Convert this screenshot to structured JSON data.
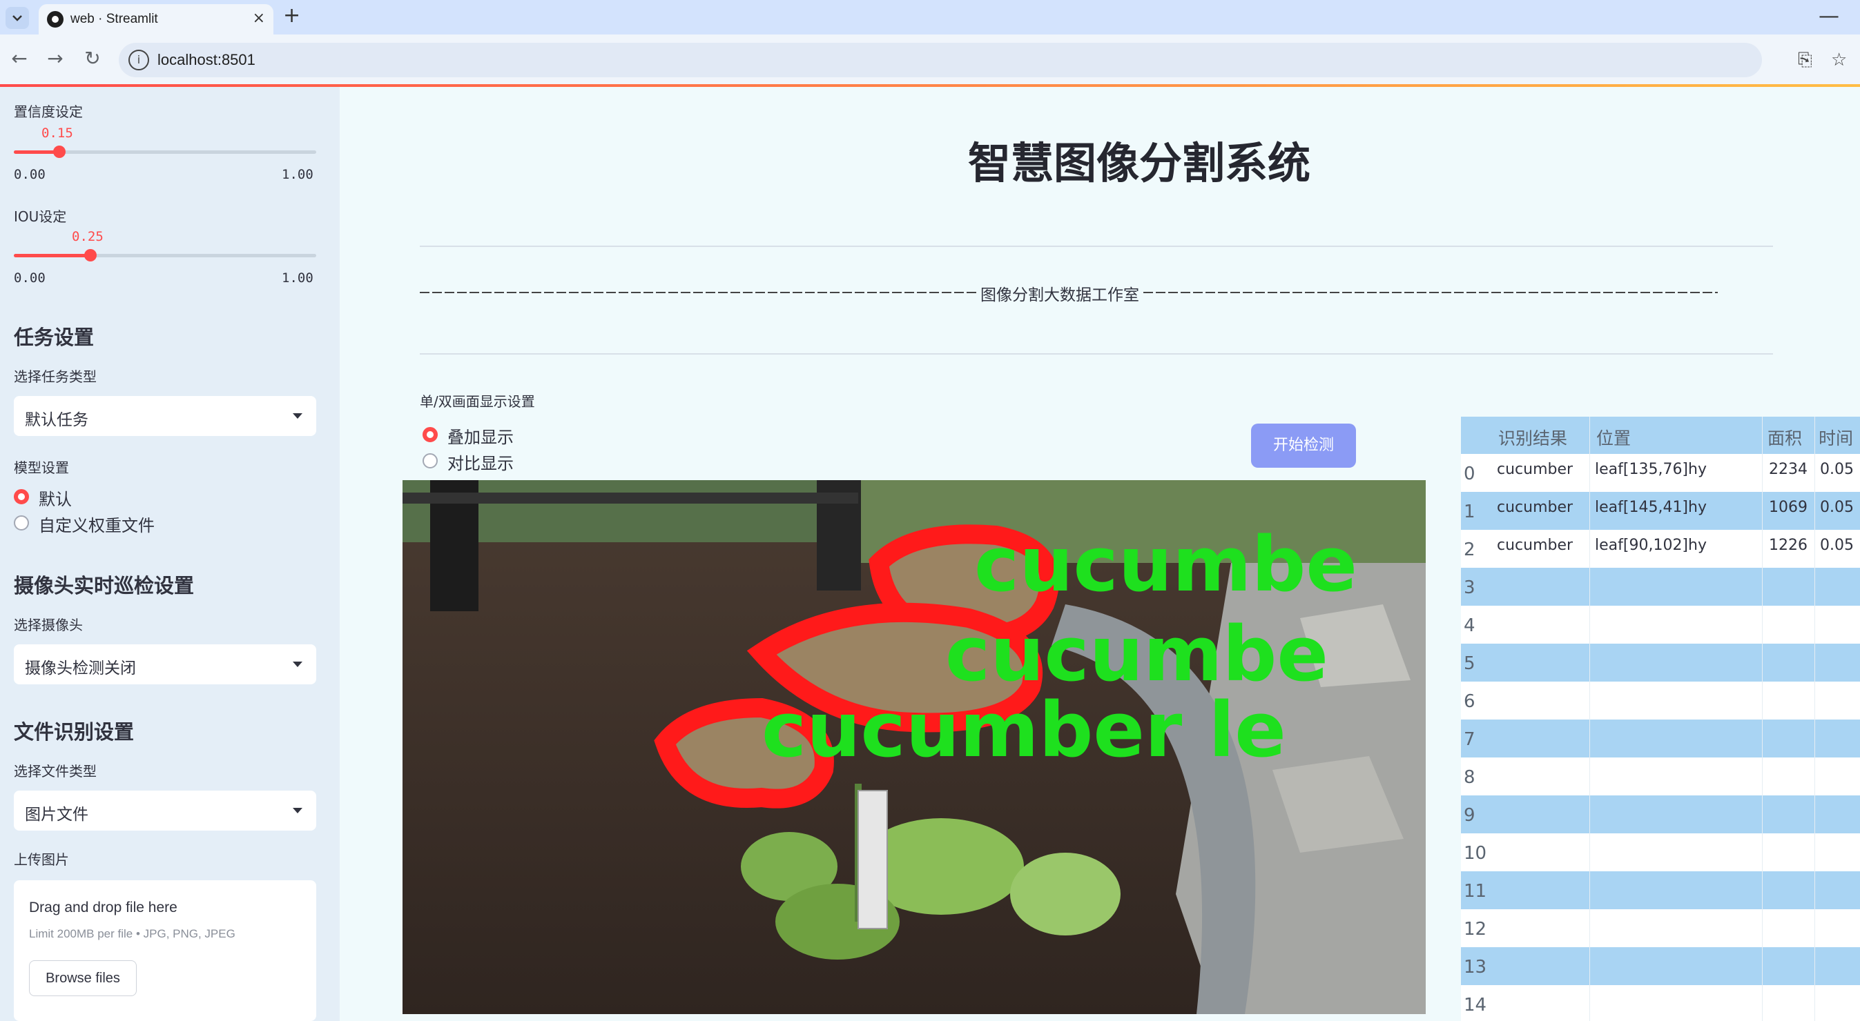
{
  "browser": {
    "tab_title": "web · Streamlit",
    "url": "localhost:8501",
    "tab_close": "×",
    "new_tab": "+",
    "minimize": "—"
  },
  "sidebar": {
    "confidence": {
      "label": "置信度设定",
      "value": "0.15",
      "value_fraction": 0.15,
      "min": "0.00",
      "max": "1.00"
    },
    "iou": {
      "label": "IOU设定",
      "value": "0.25",
      "value_fraction": 0.25,
      "min": "0.00",
      "max": "1.00"
    },
    "task_heading": "任务设置",
    "task_label": "选择任务类型",
    "task_value": "默认任务",
    "model_label": "模型设置",
    "model_options": [
      "默认",
      "自定义权重文件"
    ],
    "camera_heading": "摄像头实时巡检设置",
    "camera_label": "选择摄像头",
    "camera_value": "摄像头检测关闭",
    "file_heading": "文件识别设置",
    "file_type_label": "选择文件类型",
    "file_type_value": "图片文件",
    "upload_label": "上传图片",
    "upload": {
      "title": "Drag and drop file here",
      "subtitle": "Limit 200MB per file • JPG, PNG, JPEG",
      "button": "Browse files"
    }
  },
  "main": {
    "title": "智慧图像分割系统",
    "divider_text": "图像分割大数据工作室",
    "display_label": "单/双画面显示设置",
    "display_options": [
      "叠加显示",
      "对比显示"
    ],
    "detect_button": "开始检测",
    "image_labels": [
      "cucumbe",
      "cucumbe",
      "cucumber  le"
    ]
  },
  "table": {
    "headers": [
      "识别结果",
      "位置",
      "面积",
      "时间"
    ],
    "rows": [
      {
        "idx": "0",
        "result": "cucumber",
        "position": "leaf[135,76]hy",
        "area": "2234",
        "time": "0.05"
      },
      {
        "idx": "1",
        "result": "cucumber",
        "position": "leaf[145,41]hy",
        "area": "1069",
        "time": "0.05"
      },
      {
        "idx": "2",
        "result": "cucumber",
        "position": "leaf[90,102]hy",
        "area": "1226",
        "time": "0.05"
      },
      {
        "idx": "3"
      },
      {
        "idx": "4"
      },
      {
        "idx": "5"
      },
      {
        "idx": "6"
      },
      {
        "idx": "7"
      },
      {
        "idx": "8"
      },
      {
        "idx": "9"
      },
      {
        "idx": "10"
      },
      {
        "idx": "11"
      },
      {
        "idx": "12"
      },
      {
        "idx": "13"
      },
      {
        "idx": "14"
      }
    ]
  },
  "colors": {
    "accent": "#ff4b4b",
    "button": "#8b9bf5",
    "table_stripe": "#a9d4f3",
    "sidebar_bg": "#e4eef7",
    "mask_outline": "#ff1a1a",
    "label_green": "#1ee01e"
  }
}
